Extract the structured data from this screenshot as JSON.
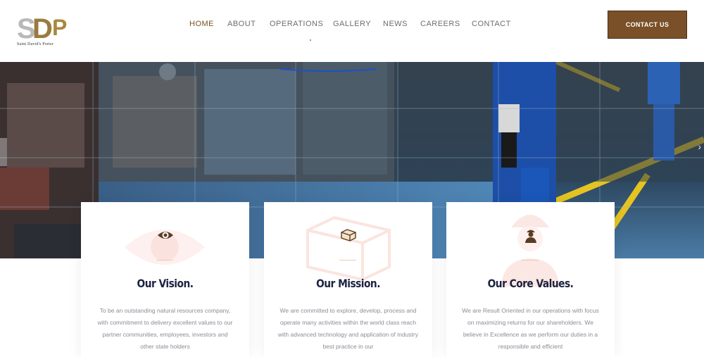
{
  "brand": {
    "logo_letters": "SDP",
    "tagline": "Saint David's Porter"
  },
  "nav": {
    "items": [
      {
        "label": "HOME",
        "active": true
      },
      {
        "label": "ABOUT",
        "active": false
      },
      {
        "label": "OPERATIONS",
        "active": false
      },
      {
        "label": "GALLERY",
        "active": false
      },
      {
        "label": "NEWS",
        "active": false
      },
      {
        "label": "CAREERS",
        "active": false
      },
      {
        "label": "CONTACT",
        "active": false
      }
    ],
    "accent": "#7a5323"
  },
  "cta": {
    "label": "CONTACT US",
    "color": "#7a5028"
  },
  "hero": {
    "next_arrow": "›",
    "icon": "industrial-plant-photo"
  },
  "cards": [
    {
      "icon": "eye-icon",
      "title": "Our Vision.",
      "text": "To be an outstanding natural resources company, with commitment to delivery excellent values to our partner communities, employees, investors and other state holders"
    },
    {
      "icon": "bricks-icon",
      "title": "Our Mission.",
      "text": "We are committed to explore, develop, process and operate many activities within the world class reach with advanced technology and application of industry best practice in our"
    },
    {
      "icon": "worker-icon",
      "title": "Our Core Values.",
      "text": "We are Result Oriented in our operations with focus on maximizing returns for our shareholders. We believe in Excellence as we perform our duties in a responsible and efficient"
    }
  ]
}
